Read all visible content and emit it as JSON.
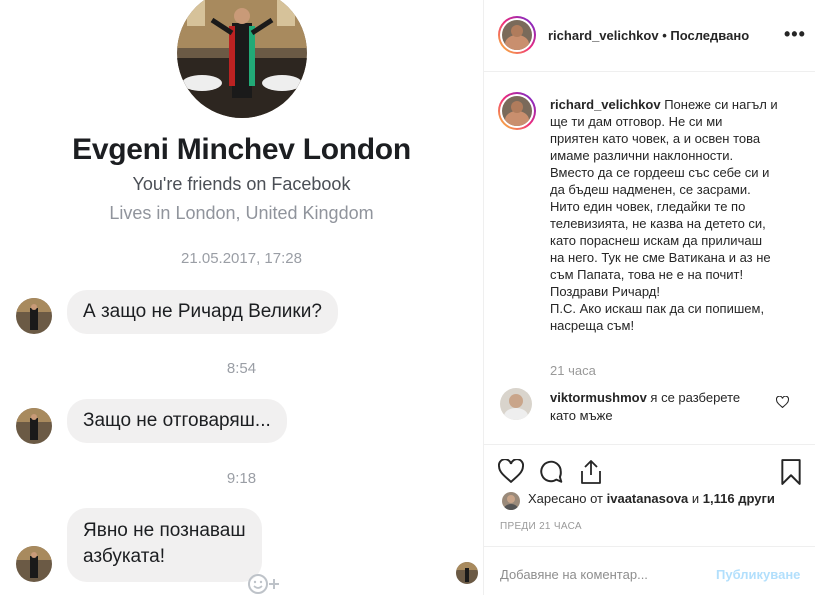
{
  "messenger": {
    "profile_name": "Evgeni Minchev London",
    "friends_text": "You're friends on Facebook",
    "lives_text": "Lives in London, United Kingdom",
    "messages": [
      {
        "timestamp": "21.05.2017, 17:28",
        "text": "А защо не Ричард Велики?"
      },
      {
        "timestamp": "8:54",
        "text": "Защо не отговаряш..."
      },
      {
        "timestamp": "9:18",
        "text_line1": "Явно не познаваш",
        "text_line2": "азбуката!"
      }
    ],
    "emoji_add_icon": "smiley-plus-icon"
  },
  "instagram": {
    "header": {
      "username": "richard_velichkov",
      "separator": "•",
      "follow_status": "Последвано",
      "more_icon": "ellipsis-icon",
      "more_label": "•••"
    },
    "caption": {
      "username": "richard_velichkov",
      "lines": [
        "Понеже си нагъл и",
        "ще ти дам отговор. Не си ми",
        "приятен като човек, а и освен това",
        "имаме различни наклонности.",
        "Вместо да се гордееш със себе си и",
        "да бъдеш надменен, се засрами.",
        "Нито един човек, гледайки те по",
        "телевизията, не казва на детето си,",
        "като пораснеш искам да приличаш",
        "на него. Тук не сме Ватикана и аз не",
        "съм Папата, това не е на почит!",
        "Поздрави Ричард!",
        "П.С. Ако искаш пак да си попишем,",
        "насреща съм!"
      ],
      "time_ago": "21 часа"
    },
    "comment": {
      "username": "viktormushmov",
      "text_line1": " я се разберете",
      "text_line2": "като мъже"
    },
    "actions": {
      "like_icon": "heart-icon",
      "comment_icon": "comment-icon",
      "share_icon": "share-icon",
      "save_icon": "bookmark-icon"
    },
    "likes": {
      "prefix": "Харесано от ",
      "user": "ivaatanasova",
      "middle": " и ",
      "count": "1,116 други"
    },
    "posted": "ПРЕДИ 21 ЧАСА",
    "add_comment_placeholder": "Добавяне на коментар...",
    "publish_label": "Публикуване"
  }
}
